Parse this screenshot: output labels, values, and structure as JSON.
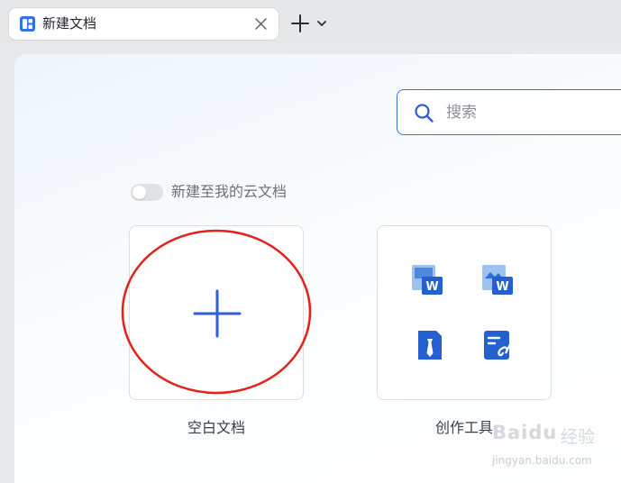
{
  "tab": {
    "title": "新建文档",
    "icon": "doc-grid-icon"
  },
  "search": {
    "placeholder": "搜索",
    "value": ""
  },
  "cloud_toggle": {
    "label": "新建至我的云文档",
    "on": false
  },
  "cards": {
    "blank": {
      "label": "空白文档"
    },
    "tools": {
      "label": "创作工具"
    }
  },
  "watermark": {
    "text": "Bai",
    "suffix": "du",
    "cn": "经验",
    "url": "jingyan.baidu.com"
  },
  "colors": {
    "accent": "#2f5fd6",
    "annotation": "#e2231a",
    "icon_blue": "#2d6fd9",
    "icon_light": "#9ec2ef"
  }
}
